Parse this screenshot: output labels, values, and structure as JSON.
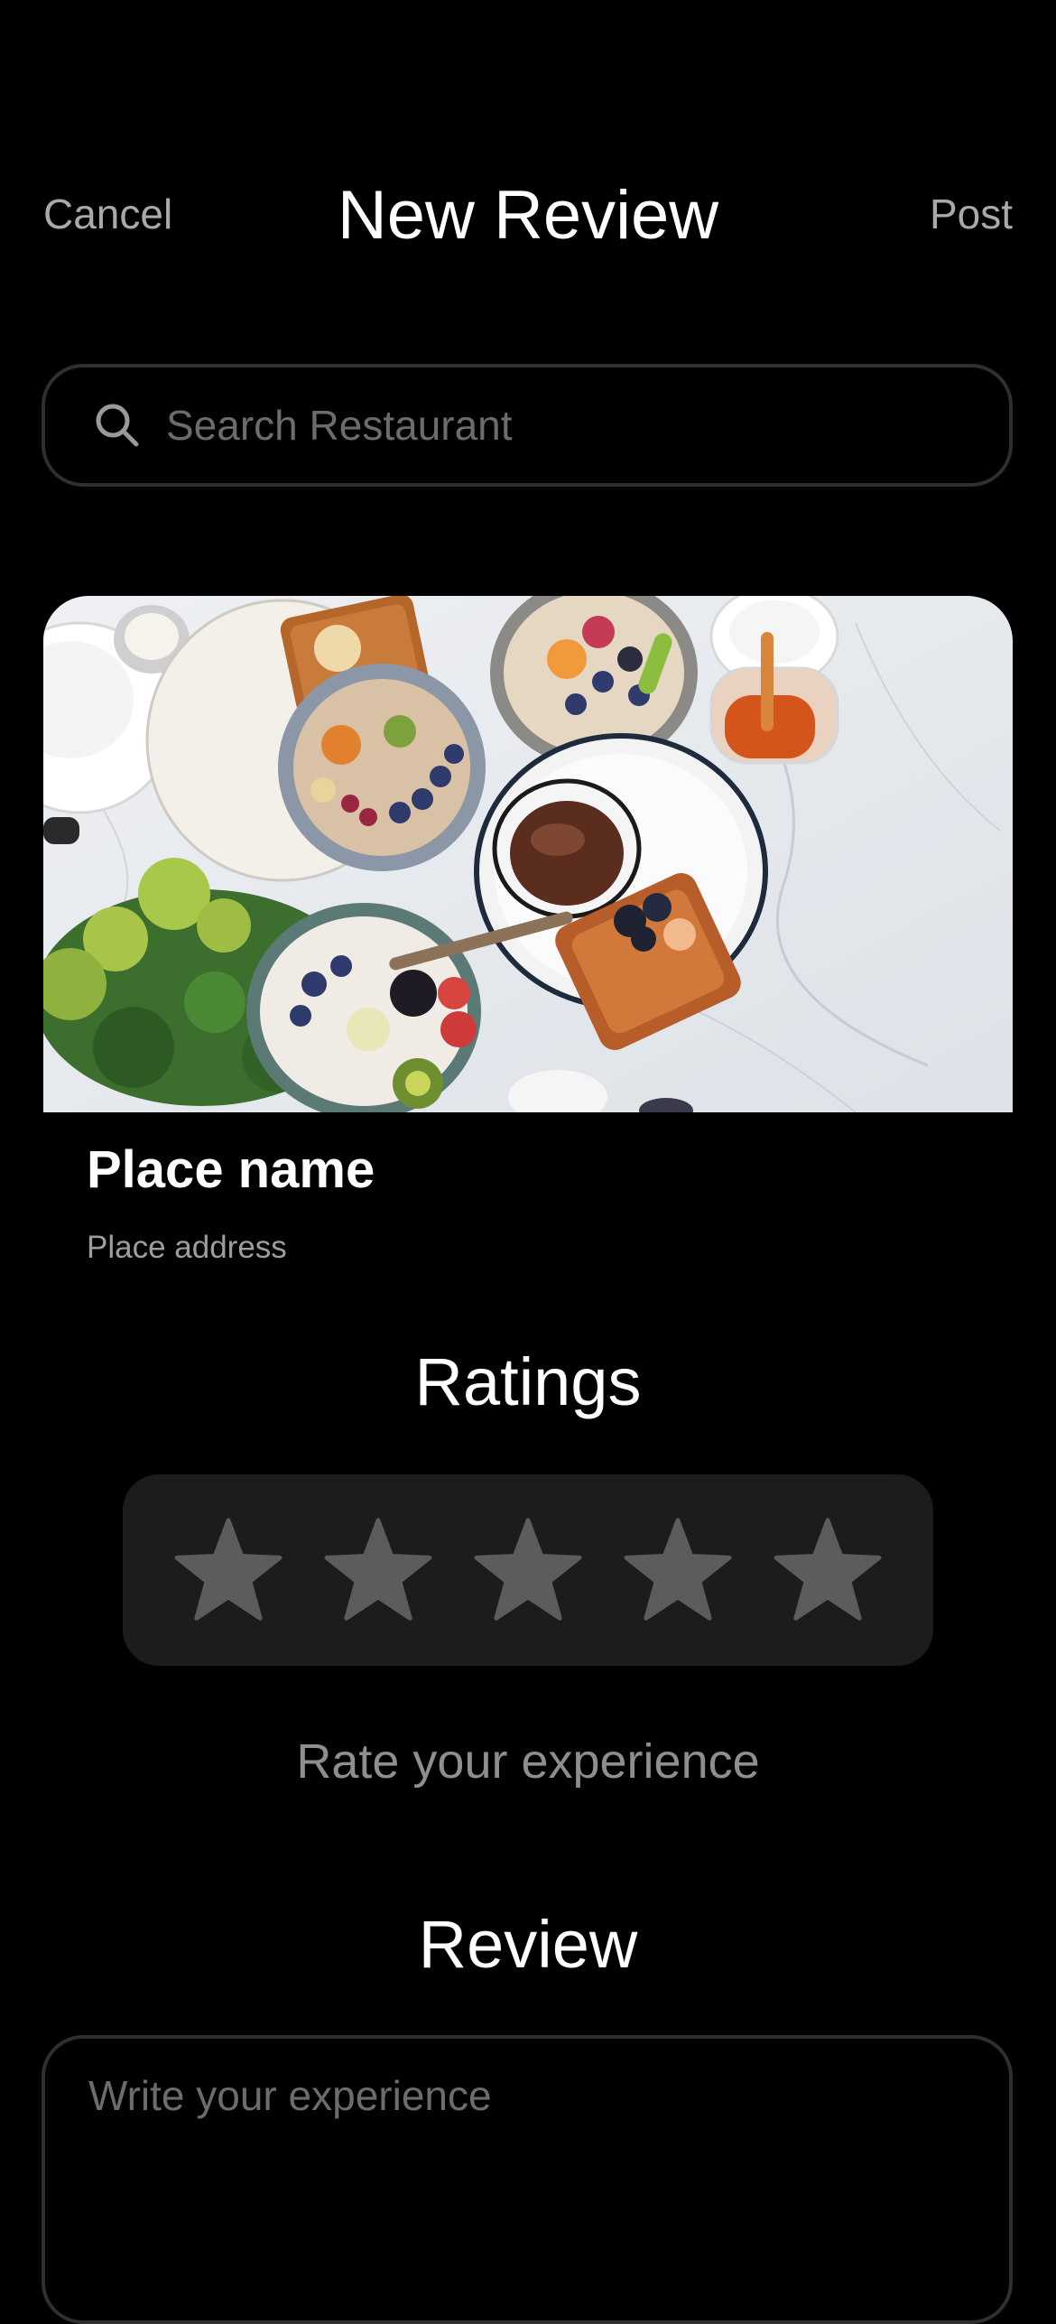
{
  "header": {
    "cancel_label": "Cancel",
    "title": "New Review",
    "post_label": "Post"
  },
  "search": {
    "placeholder": "Search Restaurant",
    "value": "",
    "icon": "search-icon"
  },
  "place": {
    "name": "Place name",
    "address": "Place address"
  },
  "ratings": {
    "title": "Ratings",
    "max_stars": 5,
    "selected": 0,
    "star_color": "#5c5c5e",
    "prompt": "Rate your experience"
  },
  "review": {
    "title": "Review",
    "placeholder": "Write your experience",
    "value": ""
  },
  "colors": {
    "background": "#000000",
    "primary_text": "#ffffff",
    "secondary_text": "#a9a9a9",
    "field_border": "#2f2f2f",
    "rating_panel": "#1c1c1c"
  }
}
